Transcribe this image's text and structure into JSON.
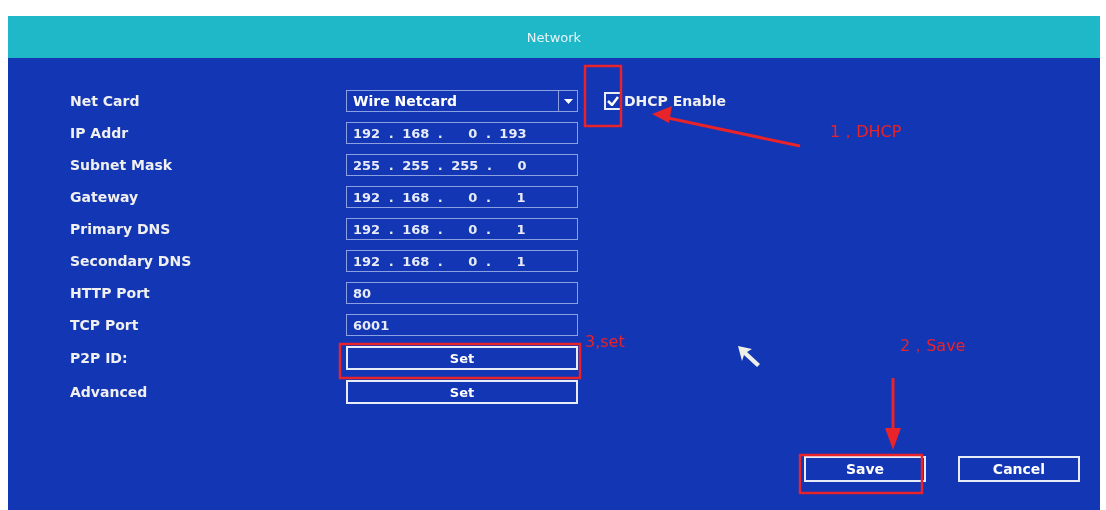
{
  "window": {
    "title": "Network"
  },
  "rows": [
    {
      "kind": "dropdown",
      "label": "Net Card",
      "value": "Wire Netcard"
    },
    {
      "kind": "ip",
      "label": "IP Addr",
      "value": "192 . 168 .   0 . 193"
    },
    {
      "kind": "ip",
      "label": "Subnet Mask",
      "value": "255 . 255 . 255 .   0"
    },
    {
      "kind": "ip",
      "label": "Gateway",
      "value": "192 . 168 .   0 .   1"
    },
    {
      "kind": "ip",
      "label": "Primary DNS",
      "value": "192 . 168 .   0 .   1"
    },
    {
      "kind": "ip",
      "label": "Secondary DNS",
      "value": "192 . 168 .   0 .   1"
    },
    {
      "kind": "text",
      "label": "HTTP Port",
      "value": "80"
    },
    {
      "kind": "text",
      "label": "TCP Port",
      "value": "6001"
    },
    {
      "kind": "button",
      "label": "P2P ID:",
      "value": "Set"
    },
    {
      "kind": "button",
      "label": "Advanced",
      "value": "Set"
    }
  ],
  "dhcp": {
    "label": "DHCP Enable",
    "checked": true
  },
  "buttons": [
    "Save",
    "Cancel"
  ],
  "annotations": [
    {
      "kind": "dhcp",
      "label": "1，DHCP"
    },
    {
      "kind": "save",
      "label": "2，Save"
    },
    {
      "kind": "set",
      "label": "3,set"
    }
  ]
}
